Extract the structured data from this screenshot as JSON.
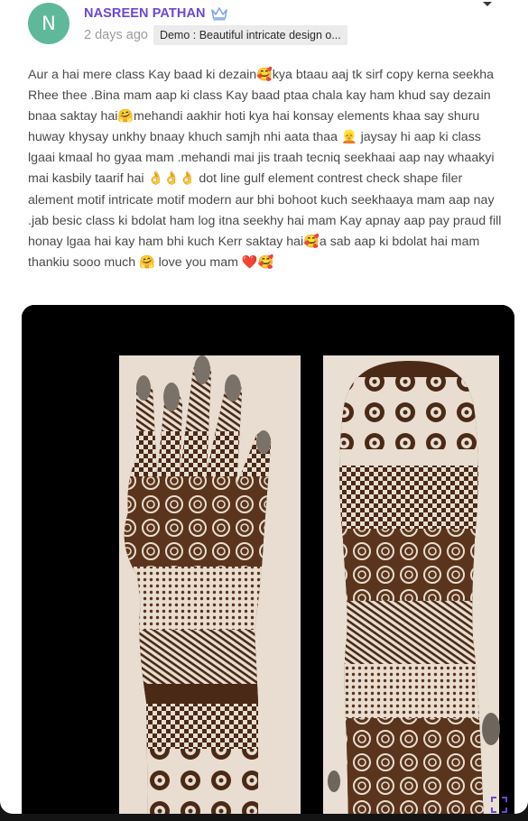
{
  "post": {
    "avatar_initial": "N",
    "author_name": "NASREEN PATHAN",
    "author_badge_icon": "crown-icon",
    "timestamp": "2 days ago",
    "course_tag": "Demo : Beautiful intricate design o...",
    "menu_icon": "chevron-down-icon",
    "comment": "Aur a hai mere class Kay baad ki dezain🥰kya btaau aaj tk sirf copy kerna seekha Rhee thee .Bina mam aap ki class Kay baad ptaa chala kay ham khud say dezain bnaa saktay hai🤗mehandi aakhir hoti kya hai konsay elements khaa say shuru huway khysay unkhy bnaay khuch samjh nhi aata thaa 👱 jaysay hi aap ki class lgaai kmaal ho gyaa mam .mehandi mai jis traah tecniq seekhaai aap nay whaakyi mai kasbily taarif hai 👌👌👌 dot line gulf element contrest check shape filer alement motif intricate motif modern aur bhi bohoot kuch seekhaaya mam aap nay .jab besic class ki bdolat ham log itna seekhy hai mam Kay apnay aap pay praud fill honay lgaa hai kay ham bhi kuch Kerr saktay hai🥰a sab aap ki bdolat hai mam thankiu sooo much 🤗 love you mam ❤️🥰",
    "expand_icon": "expand-icon"
  },
  "colors": {
    "avatar_bg": "#5fb89a",
    "author_name": "#6b46d6",
    "henna": "#4a2a16",
    "paper": "#e8ddd0"
  }
}
